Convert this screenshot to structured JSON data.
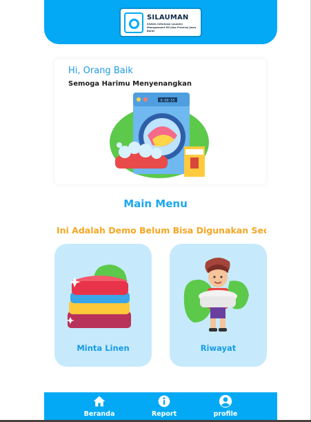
{
  "header": {
    "logo_title": "SILAUMAN",
    "logo_subtitle": "Sistem Informasi Laundry Management RS Jiwa Provinsi Jawa Barat"
  },
  "greeting_card": {
    "greeting": "Hi, Orang Baik",
    "tagline": "Semoga Harimu Menyenangkan",
    "washer_display": "0:00:55"
  },
  "main_menu": {
    "title": "Main Menu",
    "marquee": "Ini Adalah Demo Belum Bisa Digunakan Secara Umum",
    "items": [
      {
        "label": "Minta Linen"
      },
      {
        "label": "Riwayat"
      }
    ]
  },
  "bottom_nav": {
    "items": [
      {
        "label": "Beranda",
        "icon": "home-icon"
      },
      {
        "label": "Report",
        "icon": "info-icon"
      },
      {
        "label": "profile",
        "icon": "user-icon"
      }
    ]
  },
  "colors": {
    "primary": "#03a9f4",
    "card_bg": "#c6eafc",
    "accent": "#f5a623",
    "text_blue": "#1aa7ef"
  }
}
